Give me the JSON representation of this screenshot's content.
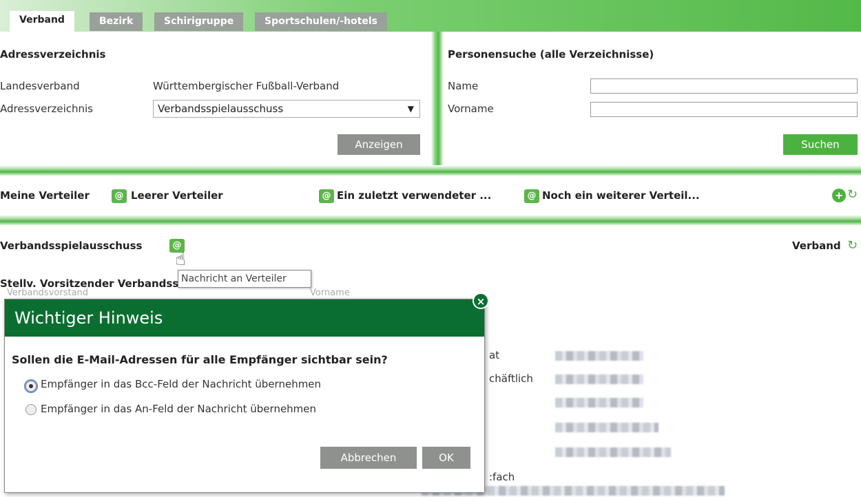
{
  "tabs": [
    "Verband",
    "Bezirk",
    "Schirigruppe",
    "Sportschulen/-hotels"
  ],
  "address": {
    "title": "Adressverzeichnis",
    "landesverband_label": "Landesverband",
    "landesverband_value": "Württembergischer Fußball-Verband",
    "verzeichnis_label": "Adressverzeichnis",
    "verzeichnis_selected": "Verbandsspielausschuss",
    "show_button": "Anzeigen"
  },
  "person_search": {
    "title": "Personensuche (alle Verzeichnisse)",
    "name_label": "Name",
    "vorname_label": "Vorname",
    "search_button": "Suchen"
  },
  "distribution": {
    "my_lists_label": "Meine Verteiler",
    "lists": [
      "Leerer Verteiler",
      "Ein zuletzt verwendeter ...",
      "Noch ein weiterer Verteil..."
    ]
  },
  "section": {
    "name": "Verbandsspielausschuss",
    "right_label": "Verband",
    "tooltip": "Nachricht an Verteiler",
    "role_partial": "Stellv. Vorsitzender Verbandsspielausschuss",
    "bg_left_label": "Verbandsvorstand",
    "bg_right_label": "Vorname",
    "bg_labels": [
      "at",
      "chäftlich",
      "",
      "",
      "",
      ":fach"
    ]
  },
  "dialog": {
    "title": "Wichtiger Hinweis",
    "question": "Sollen die E-Mail-Adressen für alle Empfänger sichtbar sein?",
    "option_bcc": "Empfänger in das Bcc-Feld der Nachricht übernehmen",
    "option_an": "Empfänger in das An-Feld der Nachricht übernehmen",
    "selected": "bcc",
    "cancel_button": "Abbrechen",
    "ok_button": "OK"
  },
  "colors": {
    "brand_green": "#0b6e31",
    "accent_green": "#4cb23f",
    "grey_button": "#8e918e"
  }
}
